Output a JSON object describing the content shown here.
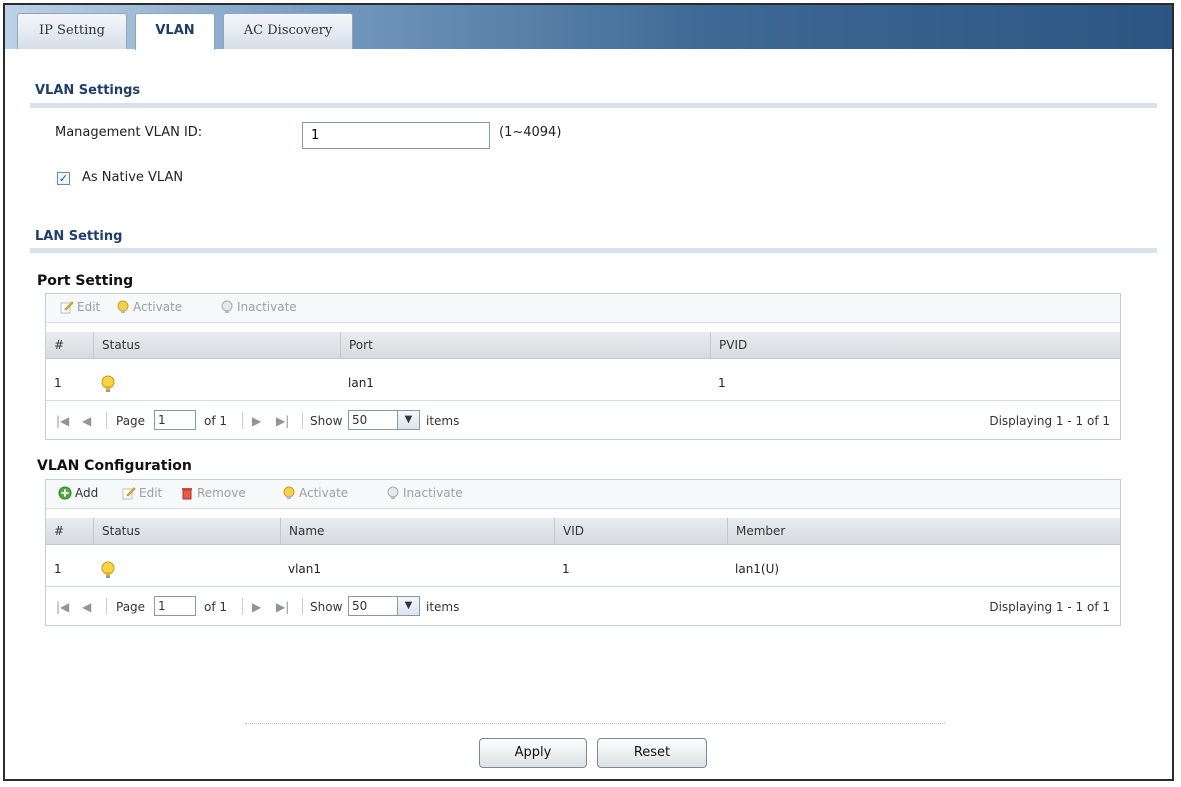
{
  "tabs": [
    {
      "label": "IP Setting",
      "active": false
    },
    {
      "label": "VLAN",
      "active": true
    },
    {
      "label": "AC Discovery",
      "active": false
    }
  ],
  "vlan_settings": {
    "title": "VLAN Settings",
    "mgmt_label": "Management VLAN ID:",
    "mgmt_value": "1",
    "mgmt_range": "(1~4094)",
    "native_label": "As Native VLAN",
    "native_checked": true
  },
  "lan_setting": {
    "title": "LAN Setting"
  },
  "port_setting": {
    "title": "Port Setting",
    "toolbar": {
      "edit": "Edit",
      "activate": "Activate",
      "inactivate": "Inactivate"
    },
    "columns": [
      "#",
      "Status",
      "Port",
      "PVID"
    ],
    "rows": [
      {
        "index": "1",
        "status": "active-bulb-icon",
        "port": "lan1",
        "pvid": "1"
      }
    ],
    "pager": {
      "page_label": "Page",
      "page": "1",
      "of": "of 1",
      "show": "Show",
      "show_value": "50",
      "items": "items",
      "displaying": "Displaying 1 - 1 of 1"
    }
  },
  "vlan_config": {
    "title": "VLAN Configuration",
    "toolbar": {
      "add": "Add",
      "edit": "Edit",
      "remove": "Remove",
      "activate": "Activate",
      "inactivate": "Inactivate"
    },
    "columns": [
      "#",
      "Status",
      "Name",
      "VID",
      "Member"
    ],
    "rows": [
      {
        "index": "1",
        "status": "active-bulb-icon",
        "name": "vlan1",
        "vid": "1",
        "member": "lan1(U)"
      }
    ],
    "pager": {
      "page_label": "Page",
      "page": "1",
      "of": "of 1",
      "show": "Show",
      "show_value": "50",
      "items": "items",
      "displaying": "Displaying 1 - 1 of 1"
    }
  },
  "buttons": {
    "apply": "Apply",
    "reset": "Reset"
  },
  "colors": {
    "section_title": "#1e3f6b",
    "tab_gradient_end": "#2c5583",
    "bulb": "#f2c230"
  }
}
